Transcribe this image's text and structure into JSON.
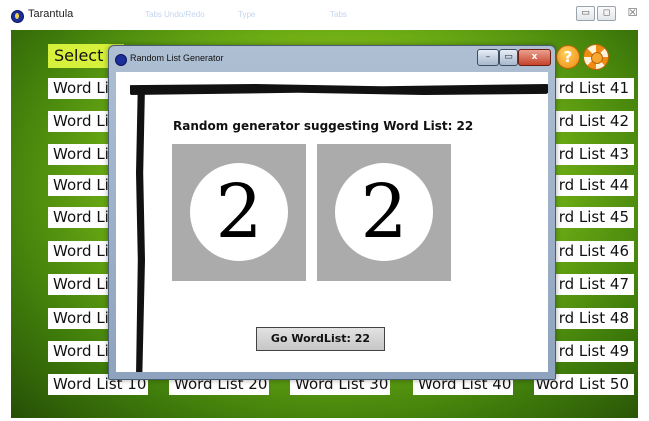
{
  "window": {
    "title": "Tarantula",
    "ghost_labels": [
      "Tabs  Undo/Redo",
      "Type",
      "Tabs"
    ],
    "minimize": "▭",
    "maximize": "◻",
    "close": "☒"
  },
  "app": {
    "select_label": "Select a",
    "help_icon": "question-mark",
    "support_icon": "lifebuoy",
    "left_lists": [
      "Word Li",
      "Word Li",
      "Word Li",
      "Word Li",
      "Word Li",
      "Word Li",
      "Word Li",
      "Word Li",
      "Word Li",
      "Word List 10"
    ],
    "right_lists": [
      "rd List 41",
      "rd List 42",
      "rd List 43",
      "rd List 44",
      "rd List 45",
      "rd List 46",
      "rd List 47",
      "rd List 48",
      "rd List 49",
      "Word List 50"
    ],
    "bottom_lists": [
      "Word List 20",
      "Word List 30",
      "Word List 40"
    ]
  },
  "dialog": {
    "title": "Random List Generator",
    "minimize": "–",
    "maximize": "▭",
    "close": "x",
    "suggest_text": "Random generator suggesting Word List: 22",
    "digits": [
      "2",
      "2"
    ],
    "go_button": "Go WordList: 22"
  }
}
